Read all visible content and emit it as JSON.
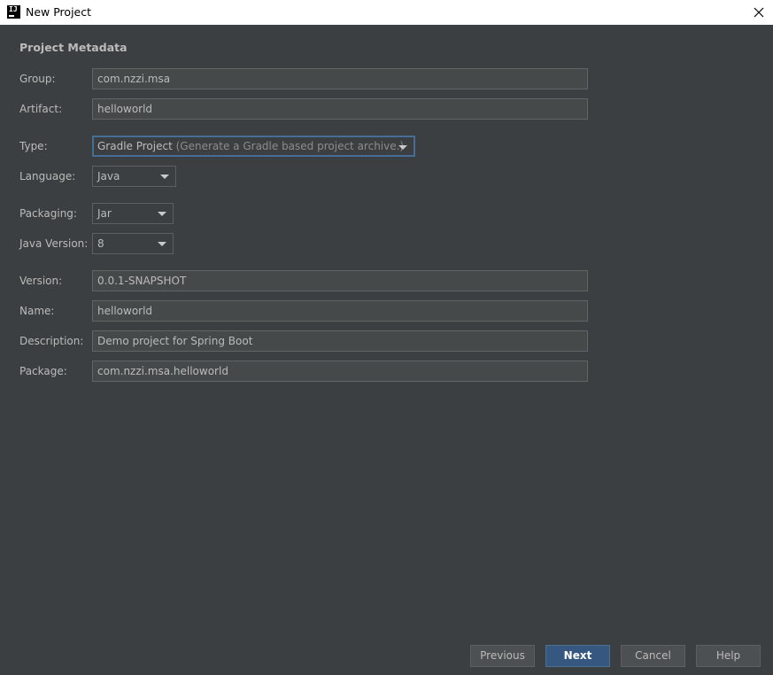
{
  "window": {
    "title": "New Project",
    "app_icon_text": "IJ"
  },
  "metadata": {
    "section_title": "Project Metadata",
    "group": {
      "label": "Group:",
      "value": "com.nzzi.msa"
    },
    "artifact": {
      "label": "Artifact:",
      "value": "helloworld"
    },
    "type": {
      "label": "Type:",
      "value": "Gradle Project",
      "hint": "(Generate a Gradle based project archive.)"
    },
    "language": {
      "label": "Language:",
      "value": "Java"
    },
    "packaging": {
      "label": "Packaging:",
      "value": "Jar"
    },
    "java_version": {
      "label": "Java Version:",
      "value": "8"
    },
    "version": {
      "label": "Version:",
      "value": "0.0.1-SNAPSHOT"
    },
    "name": {
      "label": "Name:",
      "value": "helloworld"
    },
    "description": {
      "label": "Description:",
      "value": "Demo project for Spring Boot"
    },
    "package": {
      "label": "Package:",
      "value": "com.nzzi.msa.helloworld"
    }
  },
  "buttons": {
    "previous": "Previous",
    "next": "Next",
    "cancel": "Cancel",
    "help": "Help"
  },
  "colors": {
    "background": "#3c3f41",
    "field_background": "#45494a",
    "focus_border": "#466d94",
    "primary_button": "#365880"
  }
}
